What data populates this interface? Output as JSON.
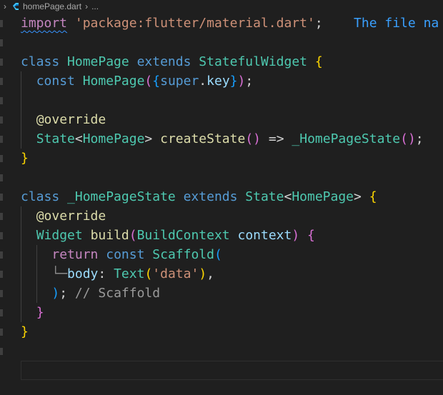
{
  "breadcrumb": {
    "file": "homePage.dart",
    "more": "..."
  },
  "theme": {
    "background": "#1f1f1f",
    "keyword": "#569cd6",
    "control": "#c586c0",
    "string": "#ce9178",
    "class": "#4ec9b0",
    "function": "#dcdcaa",
    "variable": "#9cdcfe",
    "text": "#d4d4d4",
    "comment": "#9a9a9a",
    "hint": "#3aa0ff",
    "bracket_1": "#ffd700",
    "bracket_2": "#da70d6",
    "bracket_3": "#179fff"
  },
  "code": {
    "import_kw": "import",
    "import_path": "'package:flutter/material.dart'",
    "semicolon": ";",
    "import_hint": "The file na",
    "class_kw": "class",
    "home_page": "HomePage",
    "extends_kw": "extends",
    "stateful_widget": "StatefulWidget",
    "const_kw": "const",
    "super_kw": "super",
    "key_param": "key",
    "override": "@override",
    "state_type": "State",
    "create_state": "createState",
    "arrow": "=>",
    "home_page_state": "_HomePageState",
    "widget_type": "Widget",
    "build_fn": "build",
    "build_context": "BuildContext",
    "context_param": "context",
    "return_kw": "return",
    "scaffold": "Scaffold",
    "body_param": "body",
    "text_widget": "Text",
    "data_str": "'data'",
    "scaffold_comment": "// Scaffold"
  }
}
